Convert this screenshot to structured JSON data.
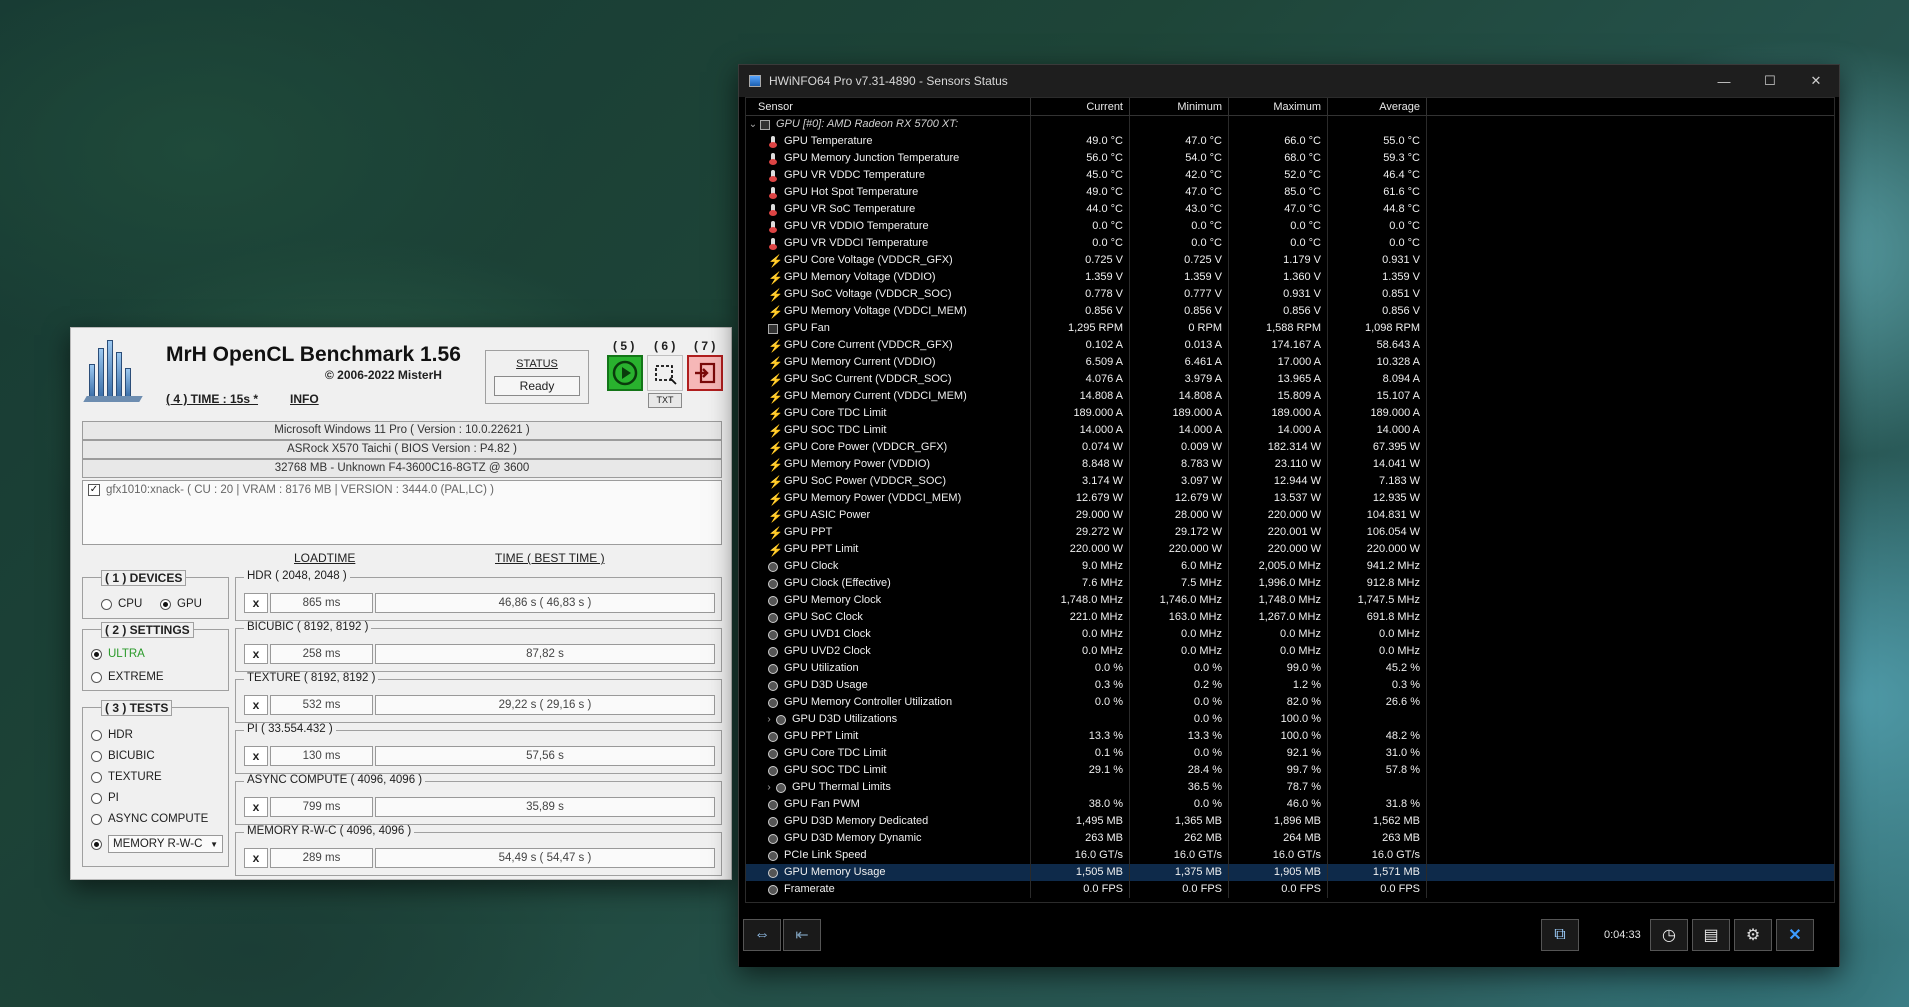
{
  "mrh": {
    "title": "MrH OpenCL Benchmark 1.56",
    "copyright": "© 2006-2022 MisterH",
    "time_link": "( 4 ) TIME : 15s *",
    "info_link": "INFO",
    "status_label": "STATUS",
    "status_value": "Ready",
    "tb_labels": [
      "( 5 )",
      "( 6 )",
      "( 7 )"
    ],
    "txt_label": "TXT",
    "sys": [
      "Microsoft Windows 11 Pro ( Version : 10.0.22621 )",
      "ASRock X570 Taichi ( BIOS Version : P4.82 )",
      "32768 MB - Unknown F4-3600C16-8GTZ @ 3600"
    ],
    "gpu_device": "gfx1010:xnack- ( CU : 20 | VRAM : 8176 MB | VERSION : 3444.0 (PAL,LC) )",
    "col_loadtime": "LOADTIME",
    "col_time": "TIME ( BEST TIME )",
    "devices": {
      "title": "( 1 ) DEVICES",
      "cpu": "CPU",
      "gpu": "GPU"
    },
    "settings": {
      "title": "( 2 ) SETTINGS",
      "ultra": "ULTRA",
      "extreme": "EXTREME"
    },
    "tests_group": {
      "title": "( 3 ) TESTS",
      "items": [
        "HDR",
        "BICUBIC",
        "TEXTURE",
        "PI",
        "ASYNC COMPUTE",
        "MEMORY R-W-C"
      ]
    },
    "tests": [
      {
        "title": "HDR ( 2048, 2048 )",
        "x": "x",
        "load": "865 ms",
        "time": "46,86 s ( 46,83 s )"
      },
      {
        "title": "BICUBIC ( 8192, 8192 )",
        "x": "x",
        "load": "258 ms",
        "time": "87,82 s"
      },
      {
        "title": "TEXTURE ( 8192, 8192 )",
        "x": "x",
        "load": "532 ms",
        "time": "29,22 s ( 29,16 s )"
      },
      {
        "title": "PI ( 33.554.432 )",
        "x": "x",
        "load": "130 ms",
        "time": "57,56 s"
      },
      {
        "title": "ASYNC COMPUTE ( 4096, 4096 )",
        "x": "x",
        "load": "799 ms",
        "time": "35,89 s"
      },
      {
        "title": "MEMORY R-W-C ( 4096, 4096 )",
        "x": "x",
        "load": "289 ms",
        "time": "54,49 s ( 54,47 s )"
      }
    ]
  },
  "hw": {
    "title": "HWiNFO64 Pro v7.31-4890 - Sensors Status",
    "headers": [
      "Sensor",
      "Current",
      "Minimum",
      "Maximum",
      "Average"
    ],
    "timer": "0:04:33",
    "rows": [
      {
        "icon": "group",
        "name": "GPU [#0]: AMD Radeon RX 5700 XT:",
        "cur": "",
        "min": "",
        "max": "",
        "avg": ""
      },
      {
        "icon": "temp",
        "name": "GPU Temperature",
        "cur": "49.0 °C",
        "min": "47.0 °C",
        "max": "66.0 °C",
        "avg": "55.0 °C"
      },
      {
        "icon": "temp",
        "name": "GPU Memory Junction Temperature",
        "cur": "56.0 °C",
        "min": "54.0 °C",
        "max": "68.0 °C",
        "avg": "59.3 °C"
      },
      {
        "icon": "temp",
        "name": "GPU VR VDDC Temperature",
        "cur": "45.0 °C",
        "min": "42.0 °C",
        "max": "52.0 °C",
        "avg": "46.4 °C"
      },
      {
        "icon": "temp",
        "name": "GPU Hot Spot Temperature",
        "cur": "49.0 °C",
        "min": "47.0 °C",
        "max": "85.0 °C",
        "avg": "61.6 °C"
      },
      {
        "icon": "temp",
        "name": "GPU VR SoC Temperature",
        "cur": "44.0 °C",
        "min": "43.0 °C",
        "max": "47.0 °C",
        "avg": "44.8 °C"
      },
      {
        "icon": "temp",
        "name": "GPU VR VDDIO Temperature",
        "cur": "0.0 °C",
        "min": "0.0 °C",
        "max": "0.0 °C",
        "avg": "0.0 °C"
      },
      {
        "icon": "temp",
        "name": "GPU VR VDDCI Temperature",
        "cur": "0.0 °C",
        "min": "0.0 °C",
        "max": "0.0 °C",
        "avg": "0.0 °C"
      },
      {
        "icon": "volt",
        "name": "GPU Core Voltage (VDDCR_GFX)",
        "cur": "0.725 V",
        "min": "0.725 V",
        "max": "1.179 V",
        "avg": "0.931 V"
      },
      {
        "icon": "volt",
        "name": "GPU Memory Voltage (VDDIO)",
        "cur": "1.359 V",
        "min": "1.359 V",
        "max": "1.360 V",
        "avg": "1.359 V"
      },
      {
        "icon": "volt",
        "name": "GPU SoC Voltage (VDDCR_SOC)",
        "cur": "0.778 V",
        "min": "0.777 V",
        "max": "0.931 V",
        "avg": "0.851 V"
      },
      {
        "icon": "volt",
        "name": "GPU Memory Voltage (VDDCI_MEM)",
        "cur": "0.856 V",
        "min": "0.856 V",
        "max": "0.856 V",
        "avg": "0.856 V"
      },
      {
        "icon": "fan",
        "name": "GPU Fan",
        "cur": "1,295 RPM",
        "min": "0 RPM",
        "max": "1,588 RPM",
        "avg": "1,098 RPM"
      },
      {
        "icon": "volt",
        "name": "GPU Core Current (VDDCR_GFX)",
        "cur": "0.102 A",
        "min": "0.013 A",
        "max": "174.167 A",
        "avg": "58.643 A"
      },
      {
        "icon": "volt",
        "name": "GPU Memory Current (VDDIO)",
        "cur": "6.509 A",
        "min": "6.461 A",
        "max": "17.000 A",
        "avg": "10.328 A"
      },
      {
        "icon": "volt",
        "name": "GPU SoC Current (VDDCR_SOC)",
        "cur": "4.076 A",
        "min": "3.979 A",
        "max": "13.965 A",
        "avg": "8.094 A"
      },
      {
        "icon": "volt",
        "name": "GPU Memory Current (VDDCI_MEM)",
        "cur": "14.808 A",
        "min": "14.808 A",
        "max": "15.809 A",
        "avg": "15.107 A"
      },
      {
        "icon": "volt",
        "name": "GPU Core TDC Limit",
        "cur": "189.000 A",
        "min": "189.000 A",
        "max": "189.000 A",
        "avg": "189.000 A"
      },
      {
        "icon": "volt",
        "name": "GPU SOC TDC Limit",
        "cur": "14.000 A",
        "min": "14.000 A",
        "max": "14.000 A",
        "avg": "14.000 A"
      },
      {
        "icon": "volt",
        "name": "GPU Core Power (VDDCR_GFX)",
        "cur": "0.074 W",
        "min": "0.009 W",
        "max": "182.314 W",
        "avg": "67.395 W"
      },
      {
        "icon": "volt",
        "name": "GPU Memory Power (VDDIO)",
        "cur": "8.848 W",
        "min": "8.783 W",
        "max": "23.110 W",
        "avg": "14.041 W"
      },
      {
        "icon": "volt",
        "name": "GPU SoC Power (VDDCR_SOC)",
        "cur": "3.174 W",
        "min": "3.097 W",
        "max": "12.944 W",
        "avg": "7.183 W"
      },
      {
        "icon": "volt",
        "name": "GPU Memory Power (VDDCI_MEM)",
        "cur": "12.679 W",
        "min": "12.679 W",
        "max": "13.537 W",
        "avg": "12.935 W"
      },
      {
        "icon": "volt",
        "name": "GPU ASIC Power",
        "cur": "29.000 W",
        "min": "28.000 W",
        "max": "220.000 W",
        "avg": "104.831 W"
      },
      {
        "icon": "volt",
        "name": "GPU PPT",
        "cur": "29.272 W",
        "min": "29.172 W",
        "max": "220.001 W",
        "avg": "106.054 W"
      },
      {
        "icon": "volt",
        "name": "GPU PPT Limit",
        "cur": "220.000 W",
        "min": "220.000 W",
        "max": "220.000 W",
        "avg": "220.000 W"
      },
      {
        "icon": "clock",
        "name": "GPU Clock",
        "cur": "9.0 MHz",
        "min": "6.0 MHz",
        "max": "2,005.0 MHz",
        "avg": "941.2 MHz"
      },
      {
        "icon": "clock",
        "name": "GPU Clock (Effective)",
        "cur": "7.6 MHz",
        "min": "7.5 MHz",
        "max": "1,996.0 MHz",
        "avg": "912.8 MHz"
      },
      {
        "icon": "clock",
        "name": "GPU Memory Clock",
        "cur": "1,748.0 MHz",
        "min": "1,746.0 MHz",
        "max": "1,748.0 MHz",
        "avg": "1,747.5 MHz"
      },
      {
        "icon": "clock",
        "name": "GPU SoC Clock",
        "cur": "221.0 MHz",
        "min": "163.0 MHz",
        "max": "1,267.0 MHz",
        "avg": "691.8 MHz"
      },
      {
        "icon": "clock",
        "name": "GPU UVD1 Clock",
        "cur": "0.0 MHz",
        "min": "0.0 MHz",
        "max": "0.0 MHz",
        "avg": "0.0 MHz"
      },
      {
        "icon": "clock",
        "name": "GPU UVD2 Clock",
        "cur": "0.0 MHz",
        "min": "0.0 MHz",
        "max": "0.0 MHz",
        "avg": "0.0 MHz"
      },
      {
        "icon": "clock",
        "name": "GPU Utilization",
        "cur": "0.0 %",
        "min": "0.0 %",
        "max": "99.0 %",
        "avg": "45.2 %"
      },
      {
        "icon": "clock",
        "name": "GPU D3D Usage",
        "cur": "0.3 %",
        "min": "0.2 %",
        "max": "1.2 %",
        "avg": "0.3 %"
      },
      {
        "icon": "clock",
        "name": "GPU Memory Controller Utilization",
        "cur": "0.0 %",
        "min": "0.0 %",
        "max": "82.0 %",
        "avg": "26.6 %"
      },
      {
        "icon": "sub",
        "name": "GPU D3D Utilizations",
        "cur": "",
        "min": "0.0 %",
        "max": "100.0 %",
        "avg": ""
      },
      {
        "icon": "clock",
        "name": "GPU PPT Limit",
        "cur": "13.3 %",
        "min": "13.3 %",
        "max": "100.0 %",
        "avg": "48.2 %"
      },
      {
        "icon": "clock",
        "name": "GPU Core TDC Limit",
        "cur": "0.1 %",
        "min": "0.0 %",
        "max": "92.1 %",
        "avg": "31.0 %"
      },
      {
        "icon": "clock",
        "name": "GPU SOC TDC Limit",
        "cur": "29.1 %",
        "min": "28.4 %",
        "max": "99.7 %",
        "avg": "57.8 %"
      },
      {
        "icon": "sub",
        "name": "GPU Thermal Limits",
        "cur": "",
        "min": "36.5 %",
        "max": "78.7 %",
        "avg": ""
      },
      {
        "icon": "clock",
        "name": "GPU Fan PWM",
        "cur": "38.0 %",
        "min": "0.0 %",
        "max": "46.0 %",
        "avg": "31.8 %"
      },
      {
        "icon": "clock",
        "name": "GPU D3D Memory Dedicated",
        "cur": "1,495 MB",
        "min": "1,365 MB",
        "max": "1,896 MB",
        "avg": "1,562 MB"
      },
      {
        "icon": "clock",
        "name": "GPU D3D Memory Dynamic",
        "cur": "263 MB",
        "min": "262 MB",
        "max": "264 MB",
        "avg": "263 MB"
      },
      {
        "icon": "clock",
        "name": "PCIe Link Speed",
        "cur": "16.0 GT/s",
        "min": "16.0 GT/s",
        "max": "16.0 GT/s",
        "avg": "16.0 GT/s"
      },
      {
        "icon": "clock",
        "name": "GPU Memory Usage",
        "cur": "1,505 MB",
        "min": "1,375 MB",
        "max": "1,905 MB",
        "avg": "1,571 MB",
        "selected": true
      },
      {
        "icon": "clock",
        "name": "Framerate",
        "cur": "0.0 FPS",
        "min": "0.0 FPS",
        "max": "0.0 FPS",
        "avg": "0.0 FPS"
      }
    ]
  }
}
